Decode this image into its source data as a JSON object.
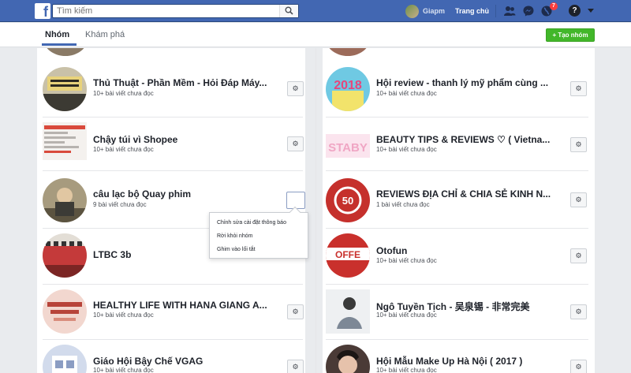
{
  "topbar": {
    "logo": "f",
    "search_placeholder": "Tìm kiếm",
    "profile_name": "Giapm",
    "home_label": "Trang chủ",
    "notification_count": "7",
    "help": "?"
  },
  "tabs": {
    "groups_label": "Nhóm",
    "explore_label": "Khám phá",
    "create_label": "+ Tạo nhóm"
  },
  "left_groups": [
    {
      "name": "Thủ Thuật - Phần Mềm - Hỏi Đáp Máy...",
      "subtitle": "10+ bài viết chưa đọc"
    },
    {
      "name": "Chậy túi vì Shopee",
      "subtitle": "10+ bài viết chưa đọc"
    },
    {
      "name": "câu lạc bộ Quay phim",
      "subtitle": "9 bài viết chưa đọc"
    },
    {
      "name": "LTBC 3b",
      "subtitle": ""
    },
    {
      "name": "HEALTHY LIFE WITH HANA GIANG A...",
      "subtitle": "10+ bài viết chưa đọc"
    },
    {
      "name": "Giáo Hội Bậy Chế VGAG",
      "subtitle": "10+ bài viết chưa đọc"
    }
  ],
  "right_groups": [
    {
      "name": "Hội review - thanh lý mỹ phẩm cùng ...",
      "subtitle": "10+ bài viết chưa đọc"
    },
    {
      "name": "BEAUTY TIPS & REVIEWS ♡ ( Vietna...",
      "subtitle": "10+ bài viết chưa đọc"
    },
    {
      "name": "REVIEWS ĐỊA CHỈ & CHIA SẺ KINH N...",
      "subtitle": "1 bài viết chưa đọc"
    },
    {
      "name": "Otofun",
      "subtitle": "10+ bài viết chưa đọc"
    },
    {
      "name": "Ngô Tuyền Tịch - 吴泉锡 - 非常完美",
      "subtitle": "10+ bài viết chưa đọc"
    },
    {
      "name": "Hội Mẫu Make Up Hà Nội ( 2017 )",
      "subtitle": "10+ bài viết chưa đọc"
    }
  ],
  "dropdown": {
    "item1": "Chỉnh sửa cài đặt thông báo",
    "item2": "Rời khỏi nhóm",
    "item3": "Ghim vào lối tắt"
  },
  "avatar_badges": {
    "r0": "2018",
    "r1": "STABY",
    "r2": "50",
    "r3": "OFFE"
  },
  "colors": {
    "topbar": "#4267b2",
    "accent_green": "#42b72a",
    "background": "#e9ebee"
  }
}
